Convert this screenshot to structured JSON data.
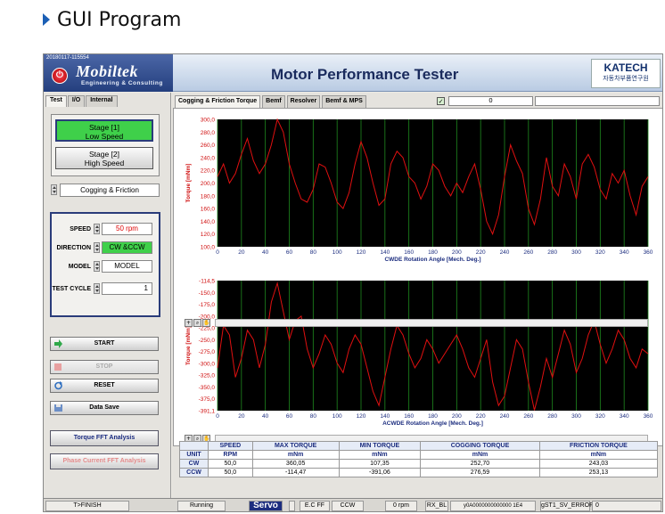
{
  "heading": "GUI Program",
  "header": {
    "stamp": "20180117-115554",
    "brand": "Mobiltek",
    "tagline": "Engineering & Consulting",
    "title": "Motor Performance Tester",
    "partner": "KATECH",
    "partner_sub": "자동차부품연구원"
  },
  "left_tabs": [
    "Test",
    "I/O",
    "Internal"
  ],
  "stages": [
    "Stage [1]\nLow Speed",
    "Stage [2]\nHigh Speed"
  ],
  "mode": "Cogging & Friction",
  "params": {
    "speed_label": "SPEED",
    "speed": "50 rpm",
    "direction_label": "DIRECTION",
    "direction": "CW &CCW",
    "model_label": "MODEL",
    "model": "MODEL",
    "cycle_label": "TEST CYCLE",
    "cycle": "1"
  },
  "buttons": {
    "start": "START",
    "stop": "STOP",
    "reset": "RESET",
    "save": "Data Save"
  },
  "fft": {
    "torque": "Torque FFT Analysis",
    "phase": "Phase Current FFT Analysis"
  },
  "chart_tabs": [
    "Cogging & Friction Torque",
    "Bemf",
    "Resolver",
    "Bemf & MPS"
  ],
  "counter": "0",
  "table": {
    "headers": [
      "",
      "SPEED",
      "MAX TORQUE",
      "MIN TORQUE",
      "COGGING TORQUE",
      "FRICTION TORQUE"
    ],
    "units": [
      "UNIT",
      "RPM",
      "mNm",
      "mNm",
      "mNm",
      "mNm"
    ],
    "rows": [
      [
        "CW",
        "50,0",
        "360,05",
        "107,35",
        "252,70",
        "243,03"
      ],
      [
        "CCW",
        "50,0",
        "-114,47",
        "-391,06",
        "276,59",
        "253,13"
      ]
    ]
  },
  "status": {
    "finish": "T>FINISH",
    "running": "Running",
    "servo": "Servo",
    "ecff": "E.C FF",
    "dir": "CCW",
    "rpm": "0 rpm",
    "rx": "RX_BL",
    "hex": "y0A0000000000000 1E4",
    "err": "gST1_SV_ERROR",
    "err_val": "0"
  },
  "chart_data": [
    {
      "type": "line",
      "title": "",
      "xlabel": "CWDE Rotation Angle [Mech. Deg.]",
      "ylabel": "Torque [mNm]",
      "xlim": [
        0,
        360
      ],
      "ylim": [
        100,
        300
      ],
      "xticks": [
        0,
        20,
        40,
        60,
        80,
        100,
        120,
        140,
        160,
        180,
        200,
        220,
        240,
        260,
        280,
        300,
        320,
        340,
        360
      ],
      "yticks": [
        "300,0",
        "280,0",
        "260,0",
        "240,0",
        "220,0",
        "200,0",
        "180,0",
        "160,0",
        "140,0",
        "120,0",
        "100,0"
      ],
      "line_color": "#e01010",
      "grid_color": "#1f8a1f",
      "x": [
        0,
        5,
        10,
        15,
        20,
        25,
        30,
        35,
        40,
        45,
        50,
        55,
        60,
        65,
        70,
        75,
        80,
        85,
        90,
        95,
        100,
        105,
        110,
        115,
        120,
        125,
        130,
        135,
        140,
        145,
        150,
        155,
        160,
        165,
        170,
        175,
        180,
        185,
        190,
        195,
        200,
        205,
        210,
        215,
        220,
        225,
        230,
        235,
        240,
        245,
        250,
        255,
        260,
        265,
        270,
        275,
        280,
        285,
        290,
        295,
        300,
        305,
        310,
        315,
        320,
        325,
        330,
        335,
        340,
        345,
        350,
        355,
        360
      ],
      "y": [
        210,
        230,
        200,
        215,
        245,
        270,
        235,
        215,
        230,
        260,
        300,
        280,
        230,
        200,
        175,
        170,
        190,
        230,
        225,
        200,
        170,
        160,
        185,
        230,
        265,
        240,
        200,
        165,
        175,
        230,
        250,
        240,
        210,
        200,
        175,
        195,
        230,
        220,
        195,
        180,
        200,
        185,
        210,
        230,
        190,
        140,
        120,
        150,
        210,
        260,
        235,
        215,
        160,
        135,
        175,
        240,
        195,
        180,
        230,
        210,
        175,
        230,
        245,
        225,
        190,
        175,
        215,
        200,
        220,
        180,
        150,
        195,
        210
      ]
    },
    {
      "type": "line",
      "title": "",
      "xlabel": "ACWDE Rotation Angle [Mech. Deg.]",
      "ylabel": "Torque [mNm]",
      "xlim": [
        0,
        360
      ],
      "ylim": [
        -391,
        -114.5
      ],
      "xticks": [
        0,
        20,
        40,
        60,
        80,
        100,
        120,
        140,
        160,
        180,
        200,
        220,
        240,
        260,
        280,
        300,
        320,
        340,
        360
      ],
      "yticks": [
        "-114,5",
        "-150,0",
        "-175,0",
        "-200,0",
        "-225,0",
        "-250,0",
        "-275,0",
        "-300,0",
        "-325,0",
        "-350,0",
        "-375,0",
        "-391,1"
      ],
      "line_color": "#e01010",
      "grid_color": "#1f8a1f",
      "x": [
        0,
        5,
        10,
        15,
        20,
        25,
        30,
        35,
        40,
        45,
        50,
        55,
        60,
        65,
        70,
        75,
        80,
        85,
        90,
        95,
        100,
        105,
        110,
        115,
        120,
        125,
        130,
        135,
        140,
        145,
        150,
        155,
        160,
        165,
        170,
        175,
        180,
        185,
        190,
        195,
        200,
        205,
        210,
        215,
        220,
        225,
        230,
        235,
        240,
        245,
        250,
        255,
        260,
        265,
        270,
        275,
        280,
        285,
        290,
        295,
        300,
        305,
        310,
        315,
        320,
        325,
        330,
        335,
        340,
        345,
        350,
        355,
        360
      ],
      "y": [
        -300,
        -210,
        -230,
        -320,
        -280,
        -220,
        -240,
        -300,
        -250,
        -160,
        -120,
        -180,
        -240,
        -200,
        -190,
        -260,
        -300,
        -270,
        -230,
        -250,
        -290,
        -310,
        -260,
        -230,
        -250,
        -300,
        -350,
        -380,
        -320,
        -260,
        -210,
        -230,
        -270,
        -300,
        -280,
        -240,
        -260,
        -290,
        -270,
        -250,
        -230,
        -260,
        -300,
        -320,
        -280,
        -240,
        -330,
        -380,
        -360,
        -300,
        -240,
        -260,
        -330,
        -390,
        -340,
        -280,
        -320,
        -270,
        -220,
        -250,
        -310,
        -280,
        -230,
        -200,
        -250,
        -290,
        -260,
        -220,
        -240,
        -280,
        -300,
        -260,
        -270
      ]
    }
  ]
}
